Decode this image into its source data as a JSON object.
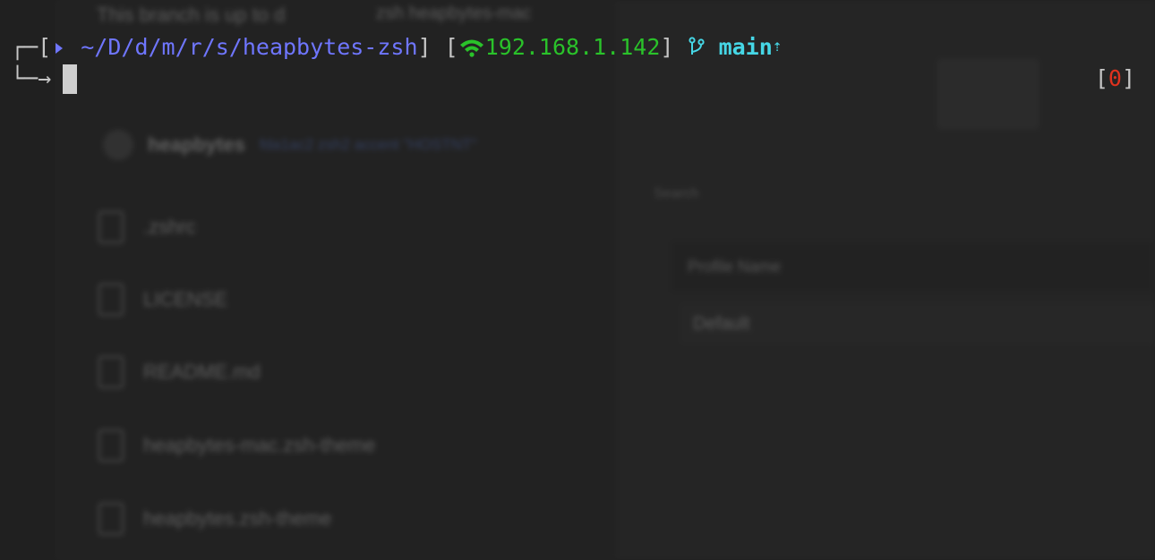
{
  "background": {
    "top_text": "This branch is up to d",
    "top_text_2": "zsh heapbytes-mac",
    "repo_name": "heapbytes",
    "repo_link": "fda1ac2 zsh2 accent \"HOSTNT\"",
    "files": [
      ".zshrc",
      "LICENSE",
      "README.md",
      "heapbytes-mac.zsh-theme",
      "heapbytes.zsh-theme"
    ],
    "search_placeholder": "Search",
    "profile_field": "Profile Name",
    "default_label": "Default"
  },
  "prompt": {
    "corner_top": "┌─",
    "corner_bottom": "└─→",
    "open_bracket": "[",
    "close_bracket": "]",
    "path": "~/D/d/m/r/s/heapbytes-zsh",
    "ip": "192.168.1.142",
    "branch": "main",
    "branch_ahead_marker": "⇡",
    "exit_status": "0"
  },
  "colors": {
    "path": "#6f76ff",
    "ip": "#2ac22a",
    "branch": "#46d7e6",
    "status": "#e0321e"
  },
  "icons": {
    "path_arrow": "play-arrow-icon",
    "wifi": "wifi-icon",
    "git_branch": "git-branch-icon"
  }
}
